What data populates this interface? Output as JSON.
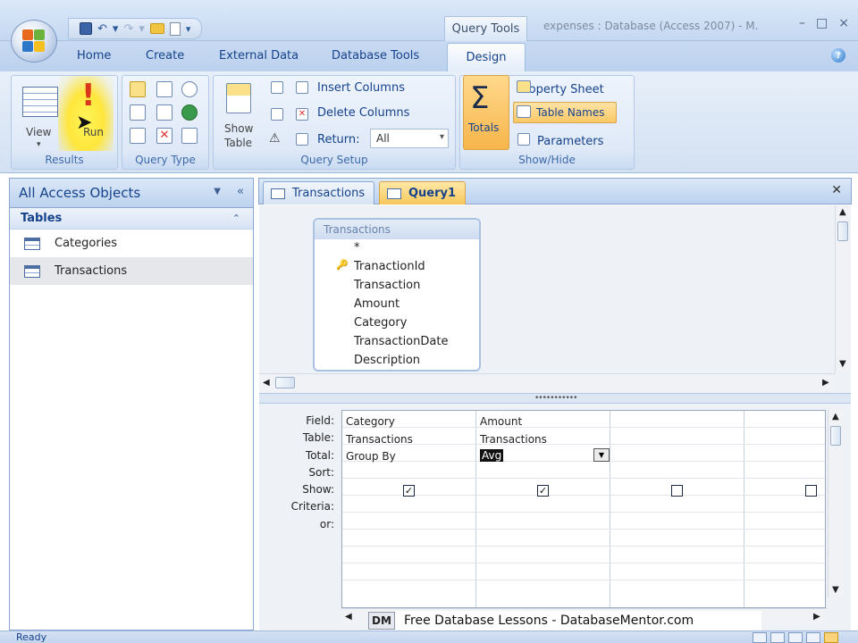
{
  "titlebar": {
    "context_tab": "Query Tools",
    "window_title": "expenses : Database (Access 2007) - M.",
    "win_min": "–",
    "win_max": "□",
    "win_close": "×"
  },
  "ribbon_tabs": [
    "Home",
    "Create",
    "External Data",
    "Database Tools",
    "Design"
  ],
  "ribbon": {
    "results": {
      "label": "Results",
      "view": "View",
      "run": "Run"
    },
    "query_type": {
      "label": "Query Type"
    },
    "query_setup": {
      "label": "Query Setup",
      "show_table_line1": "Show",
      "show_table_line2": "Table",
      "insert_columns": "Insert Columns",
      "delete_columns": "Delete Columns",
      "return_label": "Return:",
      "return_value": "All"
    },
    "show_hide": {
      "label": "Show/Hide",
      "totals": "Totals",
      "property_sheet": "Property Sheet",
      "table_names": "Table Names",
      "parameters": "Parameters"
    }
  },
  "nav": {
    "header": "All Access Objects",
    "group": "Tables",
    "items": [
      {
        "label": "Categories",
        "selected": false
      },
      {
        "label": "Transactions",
        "selected": true
      }
    ]
  },
  "doc_tabs": [
    {
      "label": "Transactions",
      "active": false
    },
    {
      "label": "Query1",
      "active": true
    }
  ],
  "field_list": {
    "title": "Transactions",
    "fields": [
      "*",
      "TranactionId",
      "Transaction",
      "Amount",
      "Category",
      "TransactionDate",
      "Description"
    ],
    "primary_key": "TranactionId"
  },
  "grid": {
    "row_labels": [
      "Field:",
      "Table:",
      "Total:",
      "Sort:",
      "Show:",
      "Criteria:",
      "or:"
    ],
    "columns": [
      {
        "field": "Category",
        "table": "Transactions",
        "total": "Group By",
        "show": true
      },
      {
        "field": "Amount",
        "table": "Transactions",
        "total": "Avg",
        "show": true
      },
      {
        "field": "",
        "table": "",
        "total": "",
        "show": false
      },
      {
        "field": "",
        "table": "",
        "total": "",
        "show": false
      }
    ]
  },
  "watermark": {
    "logo": "DM",
    "text": "Free Database Lessons - DatabaseMentor.com"
  },
  "status": {
    "text": "Ready"
  },
  "colors": {
    "ribbon_blue": "#15428b",
    "highlight_orange": "#f7c85c",
    "run_yellow": "#ffe63c"
  }
}
